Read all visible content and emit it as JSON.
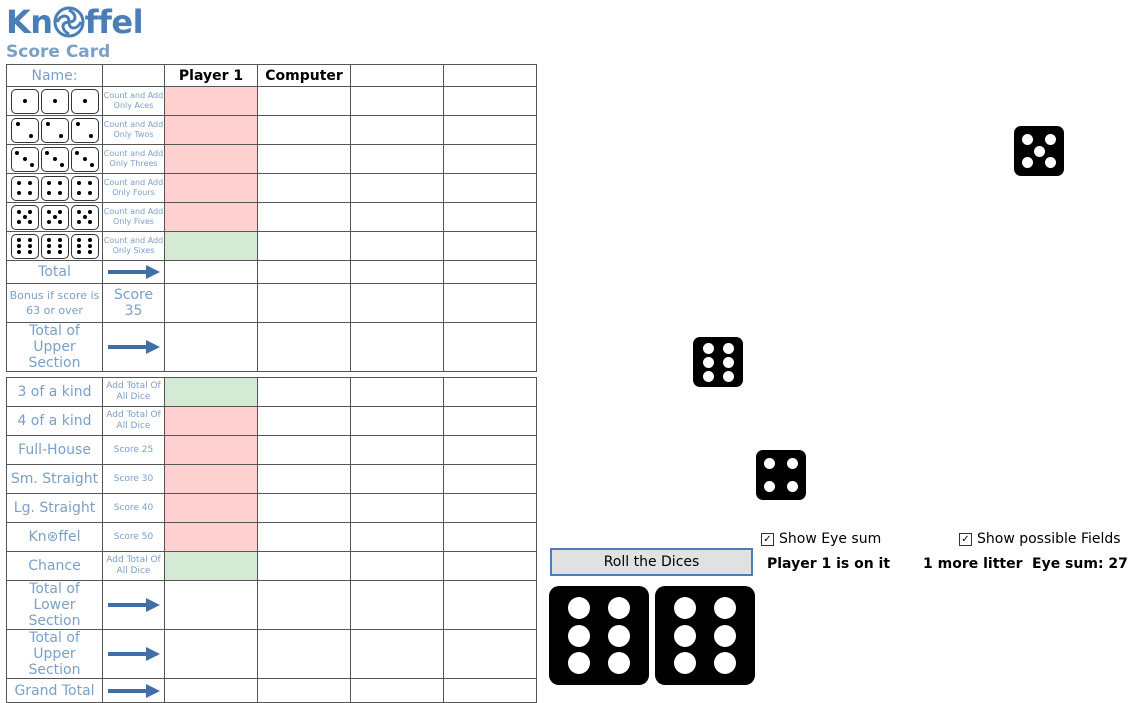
{
  "header": {
    "logo_left": "Kn",
    "logo_right": "ffel",
    "subtitle": "Score Card"
  },
  "columns": {
    "name_label": "Name:",
    "player1": "Player 1",
    "player2": "Computer"
  },
  "upper": [
    {
      "desc": "Count and Add Only Aces",
      "pips": 1,
      "p1_state": "red"
    },
    {
      "desc": "Count and Add Only Twos",
      "pips": 2,
      "p1_state": "red"
    },
    {
      "desc": "Count and Add Only Threes",
      "pips": 3,
      "p1_state": "red"
    },
    {
      "desc": "Count and Add Only Fours",
      "pips": 4,
      "p1_state": "red"
    },
    {
      "desc": "Count and Add Only Fives",
      "pips": 5,
      "p1_state": "red"
    },
    {
      "desc": "Count and Add Only Sixes",
      "pips": 6,
      "p1_state": "green"
    }
  ],
  "upper_total": "Total",
  "bonus": {
    "label": "Bonus if score is 63 or over",
    "score": "Score 35"
  },
  "upper_section_total": "Total of Upper Section",
  "lower": [
    {
      "name": "3 of a kind",
      "desc": "Add Total Of All Dice",
      "p1_state": "green"
    },
    {
      "name": "4 of a kind",
      "desc": "Add Total Of All Dice",
      "p1_state": "red"
    },
    {
      "name": "Full-House",
      "desc": "Score 25",
      "p1_state": "red"
    },
    {
      "name": "Sm. Straight",
      "desc": "Score 30",
      "p1_state": "red"
    },
    {
      "name": "Lg. Straight",
      "desc": "Score 40",
      "p1_state": "red"
    },
    {
      "name": "Kn⊛ffel",
      "desc": "Score 50",
      "p1_state": "red"
    },
    {
      "name": "Chance",
      "desc": "Add Total Of All Dice",
      "p1_state": "green"
    }
  ],
  "lower_total": "Total of Lower Section",
  "upper_total_repeat": "Total of Upper Section",
  "grand_total": "Grand Total",
  "dice": {
    "scattered": [
      5,
      6,
      4
    ],
    "held": [
      6,
      6
    ]
  },
  "controls": {
    "show_eye_sum": "Show Eye sum",
    "show_eye_sum_checked": true,
    "show_possible_fields": "Show possible Fields",
    "show_possible_fields_checked": true,
    "roll_button": "Roll the Dices",
    "turn_status": "Player 1 is on it",
    "rolls_left": "1 more litter",
    "eye_sum": "Eye sum: 27"
  },
  "colors": {
    "brand": "#4a7eb5",
    "label": "#7ba0c8",
    "possible": "#d4ead4",
    "blocked": "#ffd0d0",
    "separator": "#4a6fa0"
  }
}
